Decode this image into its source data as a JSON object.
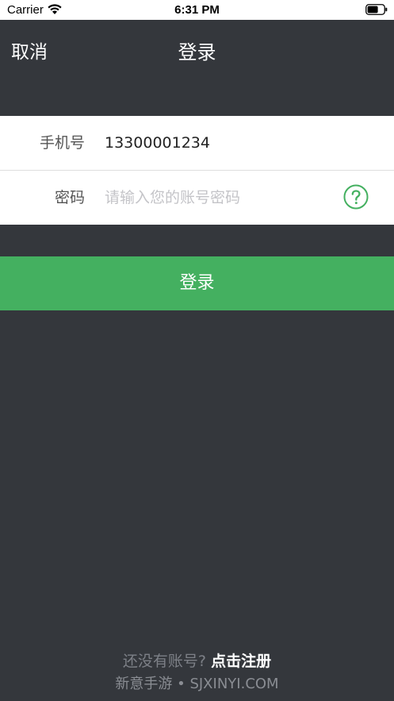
{
  "status_bar": {
    "carrier": "Carrier",
    "time": "6:31 PM",
    "wifi_icon": "wifi-icon",
    "battery_icon": "battery-icon"
  },
  "nav": {
    "cancel_label": "取消",
    "title": "登录"
  },
  "form": {
    "phone": {
      "label": "手机号",
      "value": "13300001234"
    },
    "password": {
      "label": "密码",
      "value": "",
      "placeholder": "请输入您的账号密码",
      "help_icon": "question-circle-icon"
    }
  },
  "login_button": {
    "label": "登录"
  },
  "footer": {
    "register_prompt": "还没有账号?",
    "register_link": "点击注册",
    "watermark": "新意手游 • SJXINYI.COM"
  },
  "colors": {
    "background": "#34373c",
    "accent_green": "#44b060",
    "form_background": "#ffffff",
    "placeholder": "#c4c4c8"
  }
}
